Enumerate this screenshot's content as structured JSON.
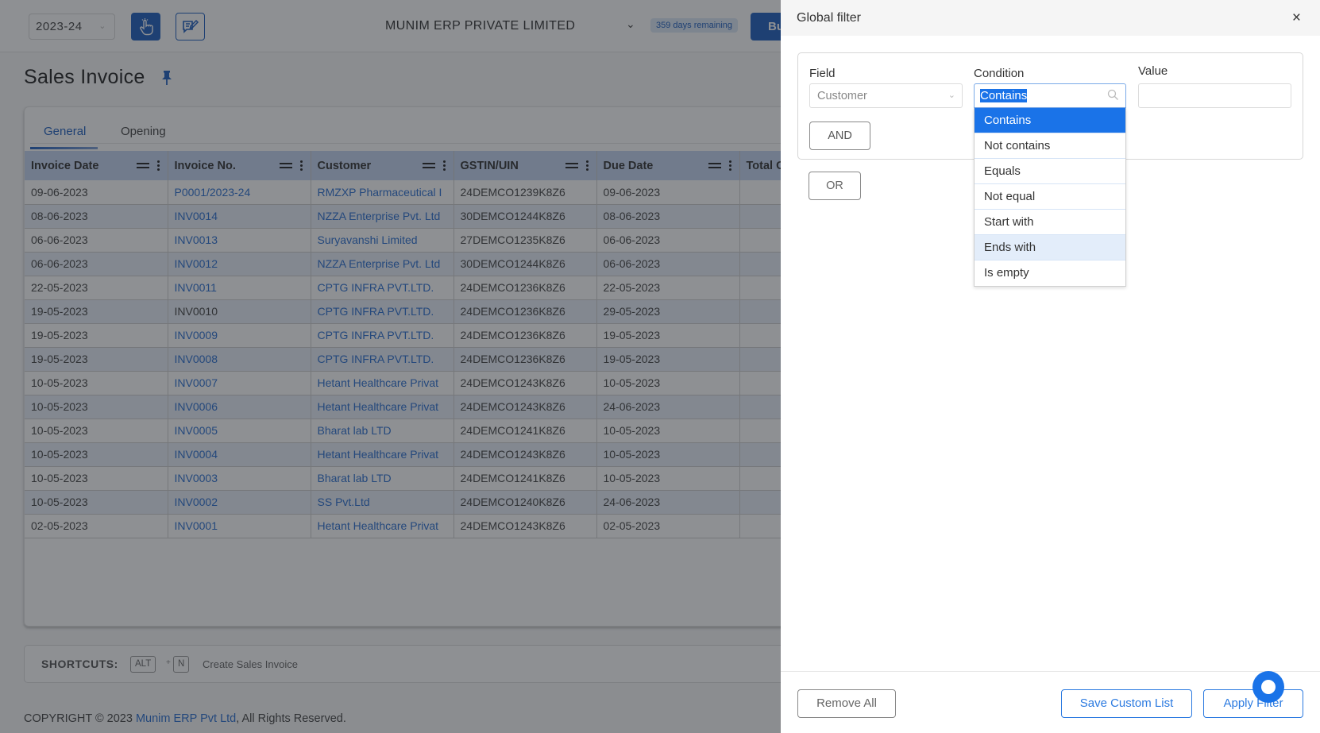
{
  "topbar": {
    "fiscal_year": "2023-24",
    "company_name": "MUNIM ERP PRIVATE LIMITED",
    "days_remaining": "359 days remaining",
    "partial_button_label": "Bu",
    "icons": [
      "hand-pointer-icon",
      "edit-note-icon"
    ]
  },
  "page": {
    "title": "Sales Invoice",
    "tabs": [
      {
        "label": "General",
        "active": true
      },
      {
        "label": "Opening",
        "active": false
      }
    ]
  },
  "table": {
    "columns": [
      "Invoice Date",
      "Invoice No.",
      "Customer",
      "GSTIN/UIN",
      "Due Date",
      "Total C"
    ],
    "rows": [
      {
        "invoice_date": "09-06-2023",
        "invoice_no": "P0001/2023-24",
        "customer": "RMZXP Pharmaceutical I",
        "gstin": "24DEMCO1239K8Z6",
        "due_date": "09-06-2023",
        "invoice_link": true
      },
      {
        "invoice_date": "08-06-2023",
        "invoice_no": "INV0014",
        "customer": "NZZA Enterprise Pvt. Ltd",
        "gstin": "30DEMCO1244K8Z6",
        "due_date": "08-06-2023",
        "invoice_link": true
      },
      {
        "invoice_date": "06-06-2023",
        "invoice_no": "INV0013",
        "customer": "Suryavanshi Limited",
        "gstin": "27DEMCO1235K8Z6",
        "due_date": "06-06-2023",
        "invoice_link": true
      },
      {
        "invoice_date": "06-06-2023",
        "invoice_no": "INV0012",
        "customer": "NZZA Enterprise Pvt. Ltd",
        "gstin": "30DEMCO1244K8Z6",
        "due_date": "06-06-2023",
        "invoice_link": true
      },
      {
        "invoice_date": "22-05-2023",
        "invoice_no": "INV0011",
        "customer": "CPTG INFRA PVT.LTD.",
        "gstin": "24DEMCO1236K8Z6",
        "due_date": "22-05-2023",
        "invoice_link": true
      },
      {
        "invoice_date": "19-05-2023",
        "invoice_no": "INV0010",
        "customer": "CPTG INFRA PVT.LTD.",
        "gstin": "24DEMCO1236K8Z6",
        "due_date": "29-05-2023",
        "invoice_link": false
      },
      {
        "invoice_date": "19-05-2023",
        "invoice_no": "INV0009",
        "customer": "CPTG INFRA PVT.LTD.",
        "gstin": "24DEMCO1236K8Z6",
        "due_date": "19-05-2023",
        "invoice_link": true
      },
      {
        "invoice_date": "19-05-2023",
        "invoice_no": "INV0008",
        "customer": "CPTG INFRA PVT.LTD.",
        "gstin": "24DEMCO1236K8Z6",
        "due_date": "19-05-2023",
        "invoice_link": true
      },
      {
        "invoice_date": "10-05-2023",
        "invoice_no": "INV0007",
        "customer": "Hetant Healthcare Privat",
        "gstin": "24DEMCO1243K8Z6",
        "due_date": "10-05-2023",
        "invoice_link": true
      },
      {
        "invoice_date": "10-05-2023",
        "invoice_no": "INV0006",
        "customer": "Hetant Healthcare Privat",
        "gstin": "24DEMCO1243K8Z6",
        "due_date": "24-06-2023",
        "invoice_link": true
      },
      {
        "invoice_date": "10-05-2023",
        "invoice_no": "INV0005",
        "customer": "Bharat lab LTD",
        "gstin": "24DEMCO1241K8Z6",
        "due_date": "10-05-2023",
        "invoice_link": true
      },
      {
        "invoice_date": "10-05-2023",
        "invoice_no": "INV0004",
        "customer": "Hetant Healthcare Privat",
        "gstin": "24DEMCO1243K8Z6",
        "due_date": "10-05-2023",
        "invoice_link": true
      },
      {
        "invoice_date": "10-05-2023",
        "invoice_no": "INV0003",
        "customer": "Bharat lab LTD",
        "gstin": "24DEMCO1241K8Z6",
        "due_date": "10-05-2023",
        "invoice_link": true
      },
      {
        "invoice_date": "10-05-2023",
        "invoice_no": "INV0002",
        "customer": "SS Pvt.Ltd",
        "gstin": "24DEMCO1240K8Z6",
        "due_date": "24-06-2023",
        "invoice_link": true
      },
      {
        "invoice_date": "02-05-2023",
        "invoice_no": "INV0001",
        "customer": "Hetant Healthcare Privat",
        "gstin": "24DEMCO1243K8Z6",
        "due_date": "02-05-2023",
        "invoice_link": true
      }
    ]
  },
  "shortcuts": {
    "label": "SHORTCUTS:",
    "keys": [
      "ALT",
      "N"
    ],
    "plus": "+",
    "description": "Create Sales Invoice"
  },
  "footer": {
    "prefix": "COPYRIGHT © 2023 ",
    "brand": "Munim ERP Pvt Ltd",
    "suffix": ", All Rights Reserved."
  },
  "filter_panel": {
    "title": "Global filter",
    "close_label": "×",
    "field_label": "Field",
    "field_value": "Customer",
    "condition_label": "Condition",
    "condition_value": "Contains",
    "value_label": "Value",
    "value_value": "",
    "and_label": "AND",
    "or_label": "OR",
    "condition_options": [
      {
        "label": "Contains",
        "state": "selected"
      },
      {
        "label": "Not contains",
        "state": ""
      },
      {
        "label": "Equals",
        "state": ""
      },
      {
        "label": "Not equal",
        "state": ""
      },
      {
        "label": "Start with",
        "state": ""
      },
      {
        "label": "Ends with",
        "state": "hover"
      },
      {
        "label": "Is empty",
        "state": ""
      }
    ],
    "remove_all_label": "Remove All",
    "save_custom_list_label": "Save Custom List",
    "apply_filter_label": "Apply Filter"
  },
  "colors": {
    "primary": "#1f5fbf",
    "link": "#2b6fd0",
    "dropdown_selected": "#1a73e8",
    "header_bg": "#c4d5f0"
  }
}
